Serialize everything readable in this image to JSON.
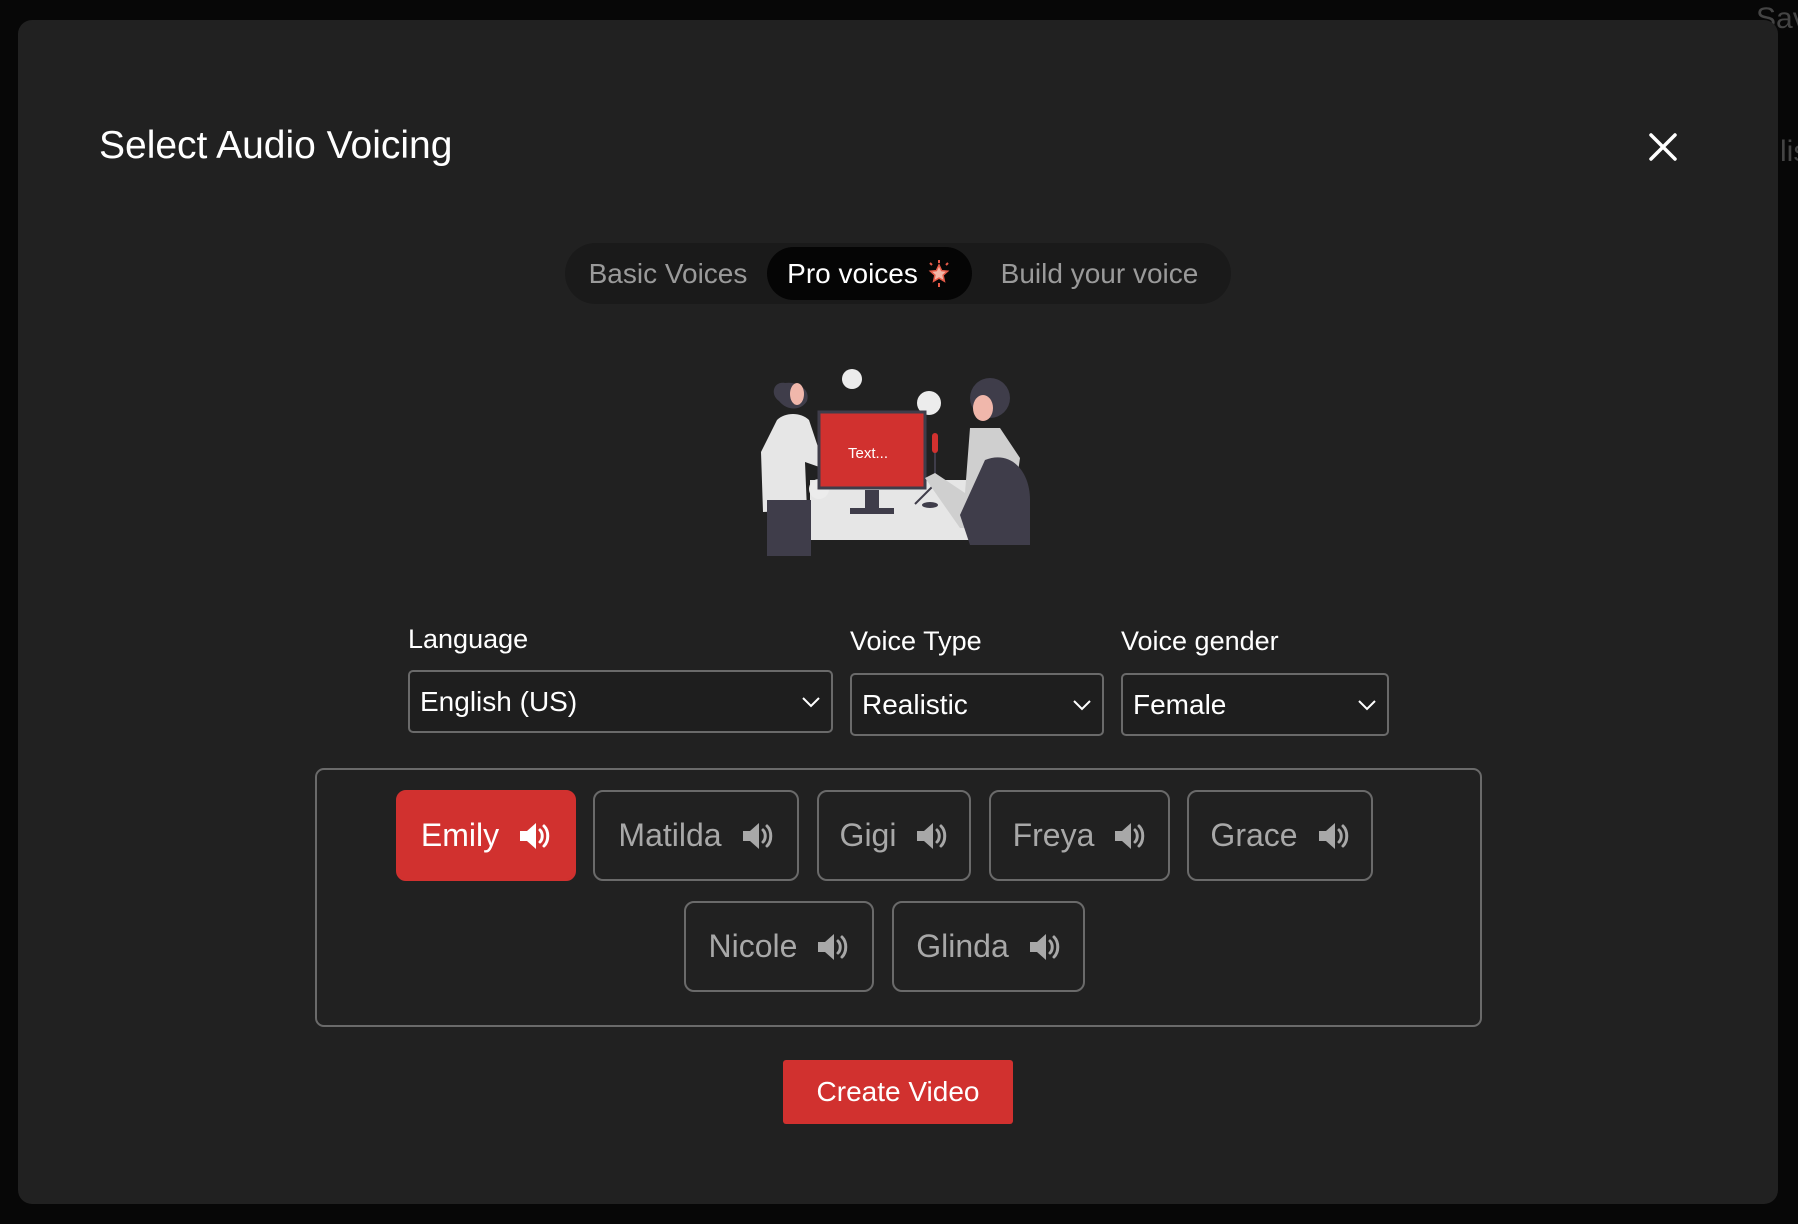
{
  "background": {
    "partial_text_top_right": "Sav",
    "partial_text_right": "lis"
  },
  "modal": {
    "title": "Select Audio Voicing",
    "close_icon": "close-icon"
  },
  "tabs": [
    {
      "label": "Basic Voices",
      "active": false
    },
    {
      "label": "Pro voices",
      "active": true,
      "badge_icon": "star-sparkle-icon"
    },
    {
      "label": "Build your voice",
      "active": false
    }
  ],
  "illustration": {
    "screen_text": "Text..."
  },
  "filters": {
    "language": {
      "label": "Language",
      "value": "English (US)"
    },
    "voice_type": {
      "label": "Voice Type",
      "value": "Realistic"
    },
    "voice_gender": {
      "label": "Voice gender",
      "value": "Female"
    }
  },
  "voices": [
    {
      "name": "Emily",
      "selected": true
    },
    {
      "name": "Matilda",
      "selected": false
    },
    {
      "name": "Gigi",
      "selected": false
    },
    {
      "name": "Freya",
      "selected": false
    },
    {
      "name": "Grace",
      "selected": false
    },
    {
      "name": "Nicole",
      "selected": false
    },
    {
      "name": "Glinda",
      "selected": false
    }
  ],
  "create_button": "Create Video",
  "colors": {
    "accent": "#d1312f",
    "modal_bg": "#212121",
    "page_bg": "#070707"
  }
}
